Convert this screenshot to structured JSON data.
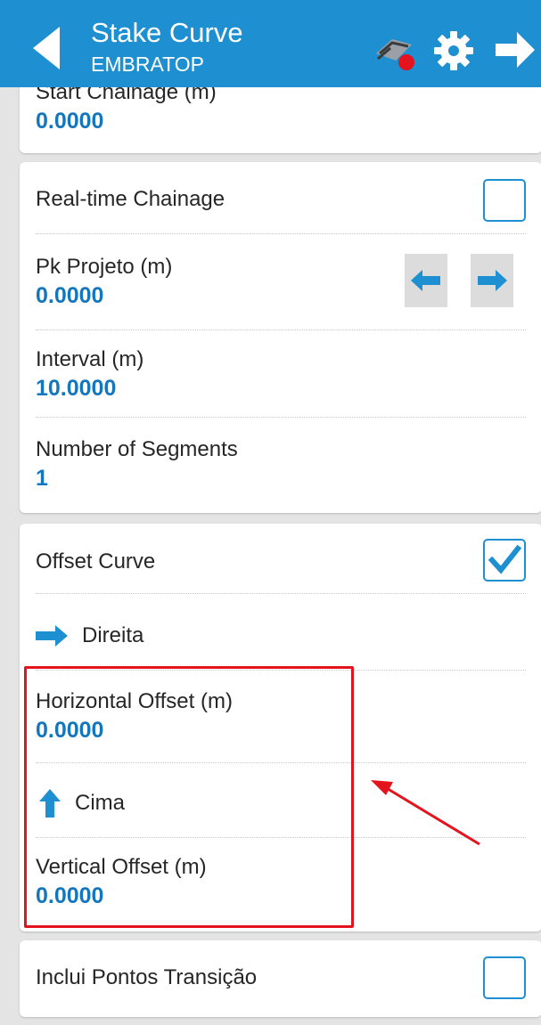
{
  "header": {
    "title": "Stake Curve",
    "subtitle": "EMBRATOP",
    "color": "#1e8fd0"
  },
  "start_card": {
    "label": "Start Chainage (m)",
    "value": "0.0000"
  },
  "chainage_card": {
    "realtime_label": "Real-time Chainage",
    "realtime_checked": false,
    "pk_label": "Pk Projeto (m)",
    "pk_value": "0.0000",
    "interval_label": "Interval (m)",
    "interval_value": "10.0000",
    "segments_label": "Number of Segments",
    "segments_value": "1"
  },
  "offset_card": {
    "offset_label": "Offset Curve",
    "offset_checked": true,
    "direction_label": "Direita",
    "horizontal_label": "Horizontal Offset (m)",
    "horizontal_value": "0.0000",
    "vertical_dir_label": "Cima",
    "vertical_label": "Vertical Offset (m)",
    "vertical_value": "0.0000"
  },
  "transition_card": {
    "label": "Inclui Pontos Transição",
    "checked": false
  },
  "colors": {
    "accent": "#1e8fd0",
    "value_text": "#1477bd",
    "annotation": "#e3141e"
  }
}
